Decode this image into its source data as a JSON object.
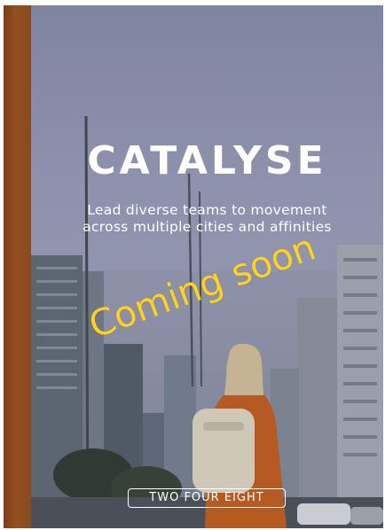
{
  "cover": {
    "title": "CATALYSE",
    "subtitle_line1": "Lead diverse teams to movement",
    "subtitle_line2": "across multiple cities and affinities",
    "overlay_text": "Coming soon",
    "publisher": "TWO FOUR EIGHT"
  },
  "colors": {
    "spine": "#8a4a1e",
    "overlay_text": "#ffd21f",
    "title": "#ffffff",
    "sky": "#8e92ad"
  }
}
